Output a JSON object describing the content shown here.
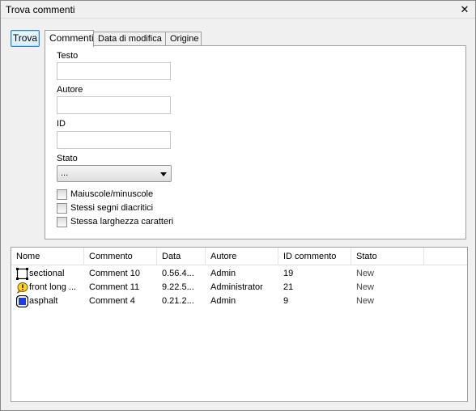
{
  "window": {
    "title": "Trova commenti",
    "close_glyph": "✕"
  },
  "toolbar": {
    "find_label": "Trova"
  },
  "tabs": [
    {
      "label": "Commenti"
    },
    {
      "label": "Data di modifica"
    },
    {
      "label": "Origine"
    }
  ],
  "form": {
    "text_label": "Testo",
    "text_value": "",
    "author_label": "Autore",
    "author_value": "",
    "id_label": "ID",
    "id_value": "",
    "status_label": "Stato",
    "status_value": "...",
    "checkboxes": [
      {
        "label": "Maiuscole/minuscole",
        "checked": false
      },
      {
        "label": "Stessi segni diacritici",
        "checked": false
      },
      {
        "label": "Stessa larghezza caratteri",
        "checked": false
      }
    ]
  },
  "results": {
    "columns": [
      "Nome",
      "Commento",
      "Data",
      "Autore",
      "ID commento",
      "Stato"
    ],
    "rows": [
      {
        "icon": "film-frame-icon",
        "name": "sectional",
        "comment": "Comment 10",
        "date": "0.56.4...",
        "author": "Admin",
        "id": "19",
        "status": "New"
      },
      {
        "icon": "warning-note-icon",
        "name": "front long ...",
        "comment": "Comment 11",
        "date": "9.22.5...",
        "author": "Administrator",
        "id": "21",
        "status": "New"
      },
      {
        "icon": "blue-square-icon",
        "name": "asphalt",
        "comment": "Comment 4",
        "date": "0.21.2...",
        "author": "Admin",
        "id": "9",
        "status": "New"
      }
    ]
  }
}
